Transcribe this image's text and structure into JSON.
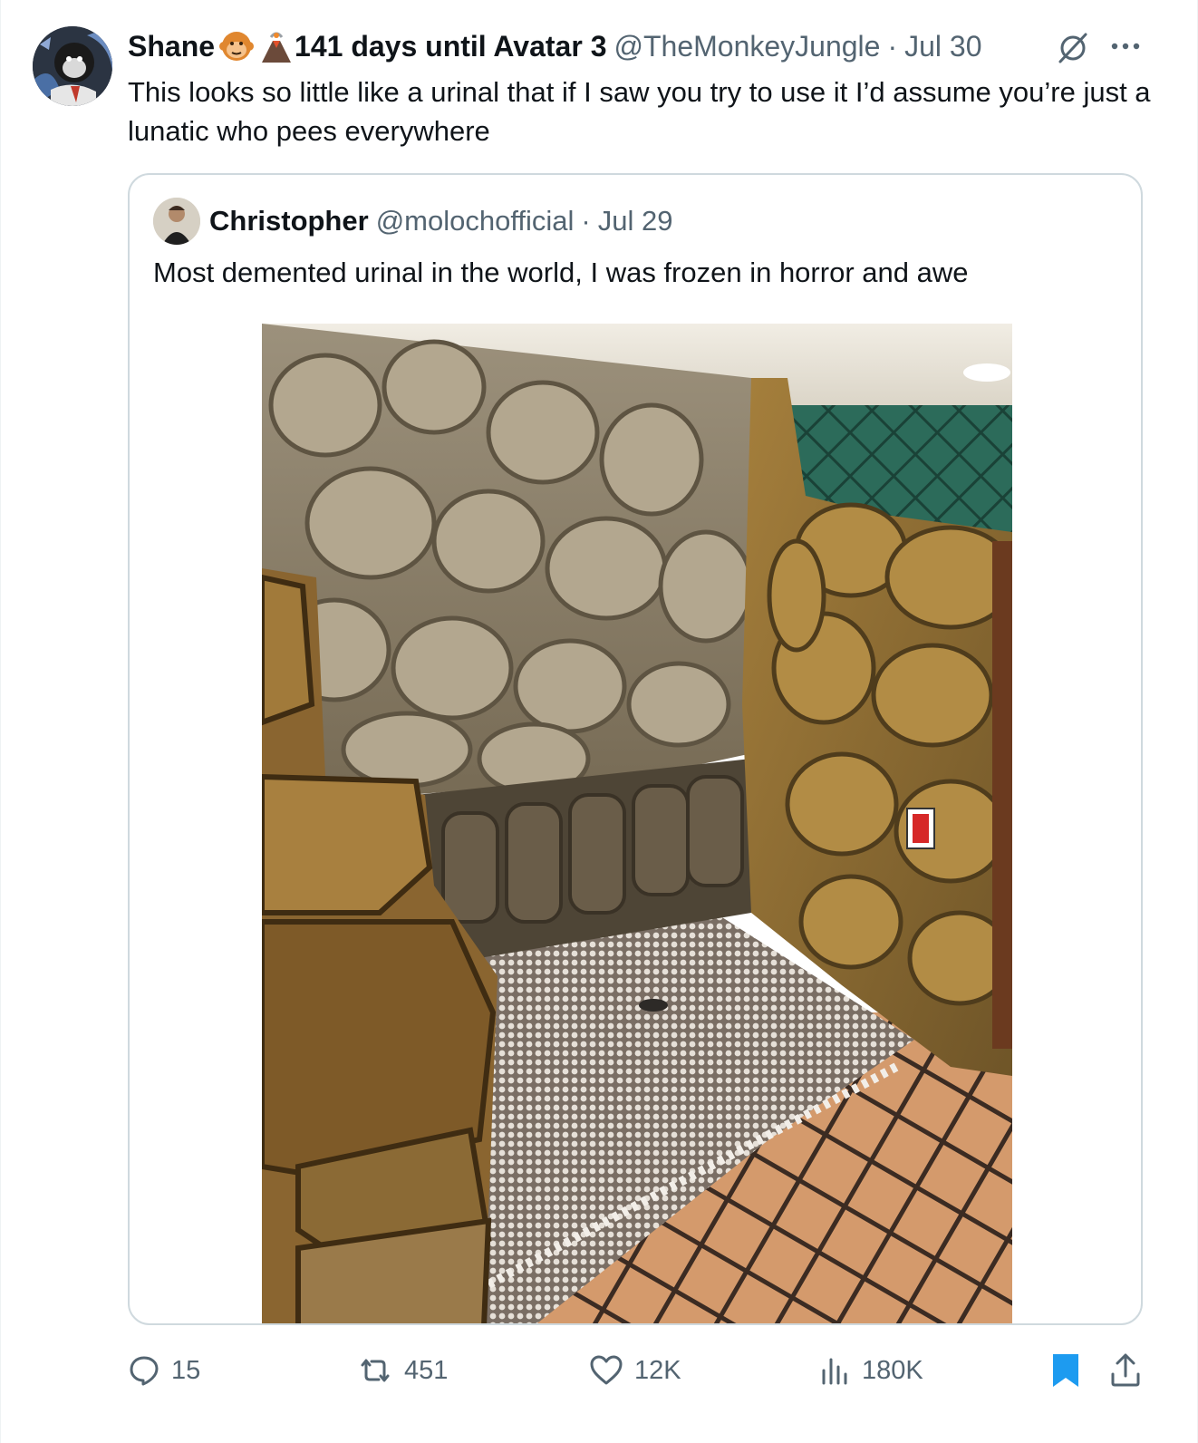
{
  "tweet": {
    "author_name": "Shane",
    "author_emojis": [
      "monkey-face-emoji",
      "volcano-emoji"
    ],
    "author_suffix": "141 days until Avatar 3",
    "handle": "@TheMonkeyJungle",
    "separator": "·",
    "date": "Jul 30",
    "text": "This looks so little like a urinal that if I saw you try to use it I’d assume you’re just a lunatic who pees everywhere"
  },
  "quoted_tweet": {
    "author_name": "Christopher",
    "handle": "@molochofficial",
    "separator": "·",
    "date": "Jul 29",
    "text": "Most demented urinal in the world, I was frozen in horror and awe"
  },
  "actions": {
    "replies": "15",
    "reposts": "451",
    "likes": "12K",
    "views": "180K"
  },
  "icons": [
    "grok-icon",
    "more-icon",
    "reply-icon",
    "repost-icon",
    "like-icon",
    "views-icon",
    "bookmark-icon",
    "share-icon"
  ],
  "colors": {
    "text_primary": "#0f1419",
    "text_secondary": "#536471",
    "border": "#cfd9de",
    "bookmark_active": "#1d9bf0"
  }
}
